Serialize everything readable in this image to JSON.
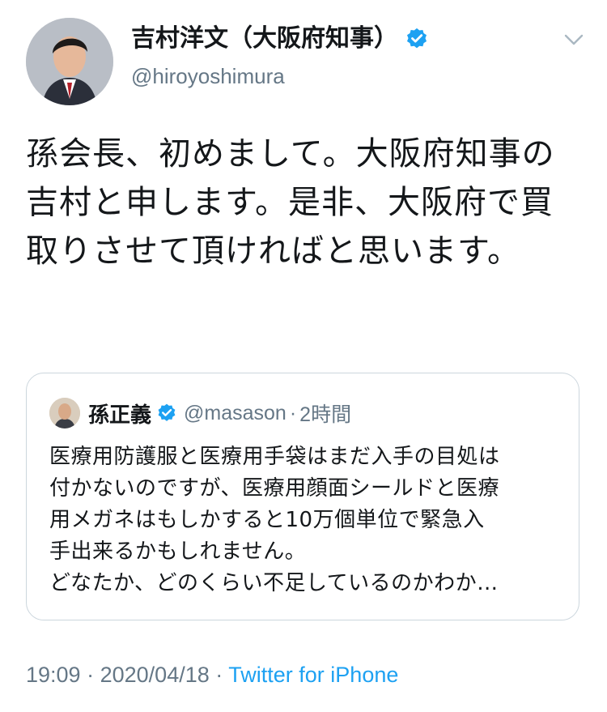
{
  "author": {
    "display_name": "吉村洋文（大阪府知事）",
    "handle": "@hiroyoshimura",
    "verified_icon": "verified-badge-icon"
  },
  "tweet": {
    "text": "孫会長、初めまして。大阪府知事の吉村と申します。是非、大阪府で買取りさせて頂ければと思います。"
  },
  "quoted_tweet": {
    "author_name": "孫正義",
    "handle": "@masason",
    "separator": "·",
    "time": "2時間",
    "lines": [
      "医療用防護服と医療用手袋はまだ入手の目処は",
      "付かないのですが、医療用顔面シールドと医療",
      "用メガネはもしかすると10万個単位で緊急入",
      "手出来るかもしれません。",
      "どなたか、どのくらい不足しているのかわか…"
    ]
  },
  "footer": {
    "time": "19:09",
    "sep1": "·",
    "date": "2020/04/18",
    "sep2": "·",
    "via": "Twitter for iPhone"
  },
  "colors": {
    "link_blue": "#1da1f2",
    "secondary_gray": "#657786",
    "border": "#ccd6dd"
  }
}
